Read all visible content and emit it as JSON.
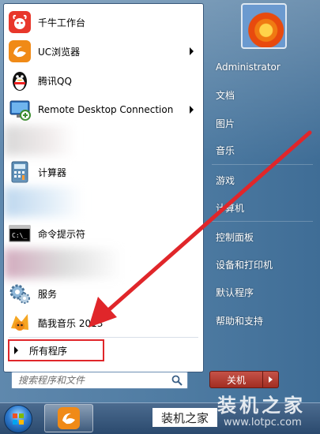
{
  "left_pane": {
    "items": [
      {
        "label": "千牛工作台",
        "icon": "qianniu-icon",
        "arrow": false
      },
      {
        "label": "UC浏览器",
        "icon": "uc-browser-icon",
        "arrow": true
      },
      {
        "label": "腾讯QQ",
        "icon": "qq-penguin-icon",
        "arrow": false
      },
      {
        "label": "Remote Desktop Connection",
        "icon": "remote-desktop-icon",
        "arrow": true
      },
      {
        "label": "计算器",
        "icon": "calculator-icon",
        "arrow": false
      },
      {
        "label": "命令提示符",
        "icon": "cmd-icon",
        "arrow": false
      },
      {
        "label": "服务",
        "icon": "services-gear-icon",
        "arrow": false
      },
      {
        "label": "酷我音乐 2013",
        "icon": "kuwo-music-icon",
        "arrow": false
      }
    ],
    "all_programs": "所有程序",
    "search_placeholder": "搜索程序和文件"
  },
  "right_pane": {
    "items": [
      "Administrator",
      "文档",
      "图片",
      "音乐",
      "游戏",
      "计算机",
      "控制面板",
      "设备和打印机",
      "默认程序",
      "帮助和支持"
    ],
    "shutdown_label": "关机"
  },
  "watermark": {
    "box_text": "装机之家",
    "big_text": "装机之家",
    "url": "www.lotpc.com"
  },
  "colors": {
    "annotation_red": "#e0262a",
    "menu_blue": "#4d7aa1"
  }
}
